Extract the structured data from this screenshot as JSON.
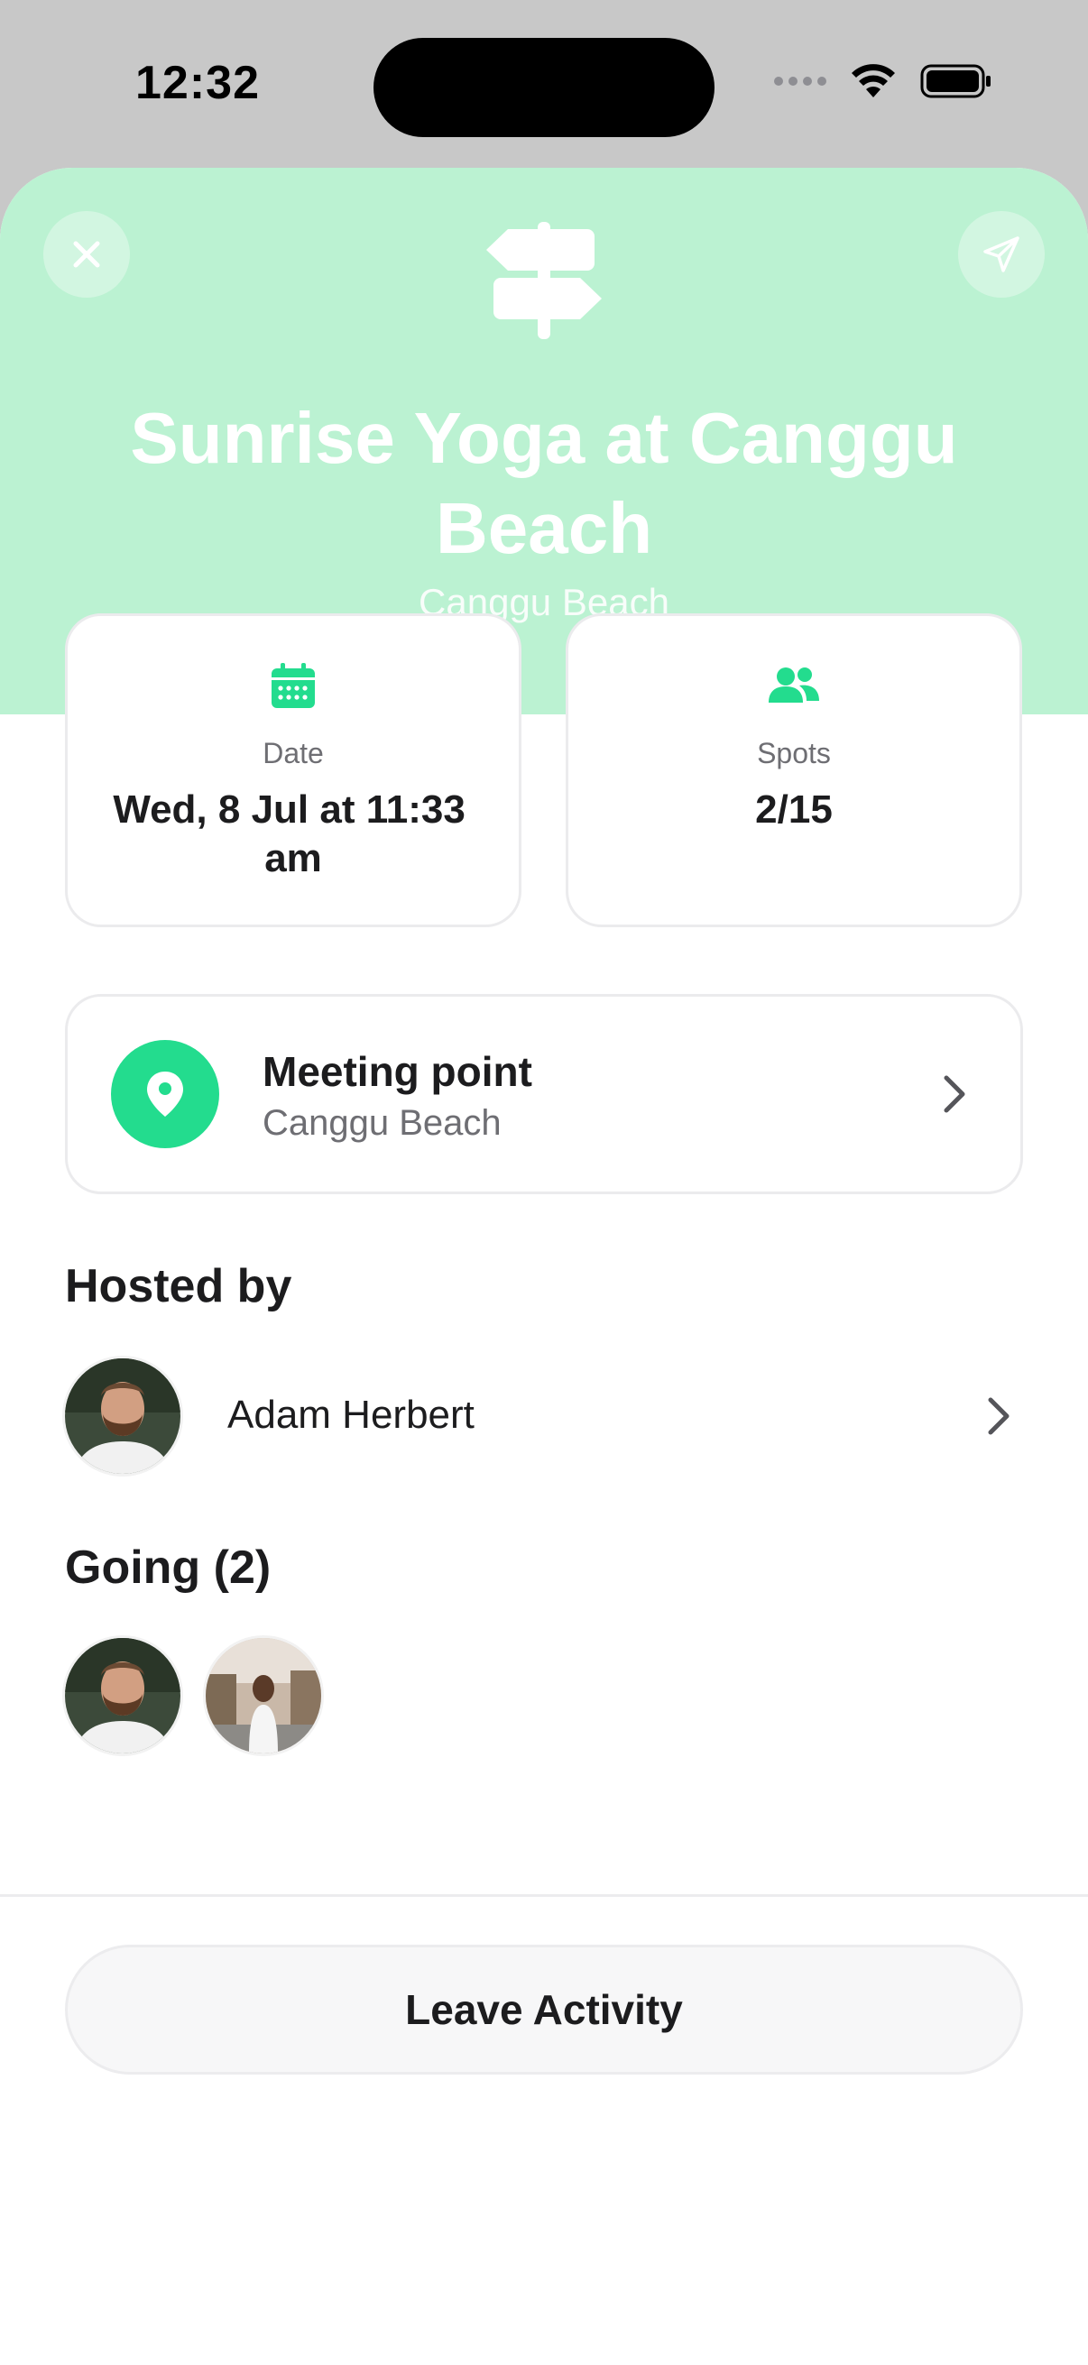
{
  "status_bar": {
    "time": "12:32"
  },
  "activity": {
    "title": "Sunrise Yoga at Canggu Beach",
    "location": "Canggu Beach"
  },
  "stats": {
    "date_label": "Date",
    "date_value": "Wed, 8 Jul at 11:33 am",
    "spots_label": "Spots",
    "spots_value": "2/15"
  },
  "meeting": {
    "title": "Meeting point",
    "place": "Canggu Beach"
  },
  "host": {
    "section_title": "Hosted by",
    "name": "Adam Herbert"
  },
  "going": {
    "section_title": "Going (2)"
  },
  "actions": {
    "leave_label": "Leave Activity"
  },
  "colors": {
    "hero_bg": "#bbf2d2",
    "accent": "#23dc8e"
  },
  "icons": {
    "close": "close-icon",
    "share": "paper-plane-icon",
    "hero": "signpost-icon",
    "date": "calendar-icon",
    "spots": "people-icon",
    "meeting": "map-pin-icon",
    "chevron": "chevron-right-icon"
  }
}
